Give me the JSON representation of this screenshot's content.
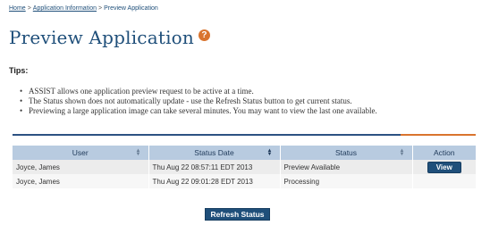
{
  "breadcrumb": {
    "items": [
      "Home",
      "Application Information",
      "Preview Application"
    ],
    "separator": ">"
  },
  "page": {
    "title": "Preview Application",
    "help_icon": "question-mark-icon",
    "help_glyph": "?"
  },
  "tips": {
    "title": "Tips:",
    "items": [
      "ASSIST allows one application preview request to be active at a time.",
      "The Status shown does not automatically update - use the Refresh Status button to get current status.",
      "Previewing a large application image can take several minutes.  You may want to view the last one available."
    ]
  },
  "table": {
    "columns": [
      "User",
      "Status Date",
      "Status",
      "Action"
    ],
    "rows": [
      {
        "user": "Joyce, James",
        "status_date": "Thu Aug 22 08:57:11 EDT 2013",
        "status": "Preview Available",
        "action": "View"
      },
      {
        "user": "Joyce, James",
        "status_date": "Thu Aug 22 09:01:28 EDT 2013",
        "status": "Processing",
        "action": ""
      }
    ]
  },
  "buttons": {
    "refresh": "Refresh Status"
  },
  "colors": {
    "accent": "#1f4f7a",
    "orange": "#d9742e",
    "header_bg": "#b8cbe0"
  }
}
